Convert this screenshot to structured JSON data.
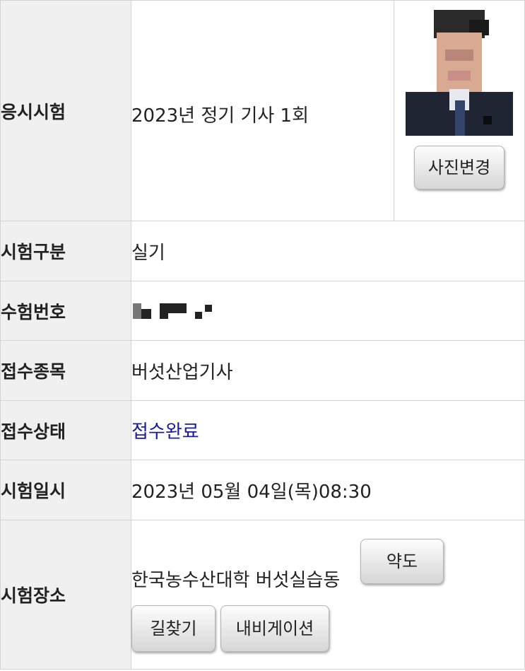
{
  "rows": {
    "exam": {
      "label": "응시시험",
      "value": "2023년 정기 기사 1회"
    },
    "exam_type": {
      "label": "시험구분",
      "value": "실기"
    },
    "exam_number": {
      "label": "수험번호"
    },
    "category": {
      "label": "접수종목",
      "value": "버섯산업기사"
    },
    "status": {
      "label": "접수상태",
      "value": "접수완료"
    },
    "datetime": {
      "label": "시험일시",
      "value": "2023년 05월 04일(목)08:30"
    },
    "location": {
      "label": "시험장소",
      "value": "한국농수산대학 버섯실습동"
    }
  },
  "buttons": {
    "photo_change": "사진변경",
    "map": "약도",
    "directions": "길찾기",
    "navigation": "내비게이션"
  },
  "colors": {
    "status": "#1a1aa0",
    "header_bg": "#f0f0f0",
    "border": "#d4d4d4"
  }
}
